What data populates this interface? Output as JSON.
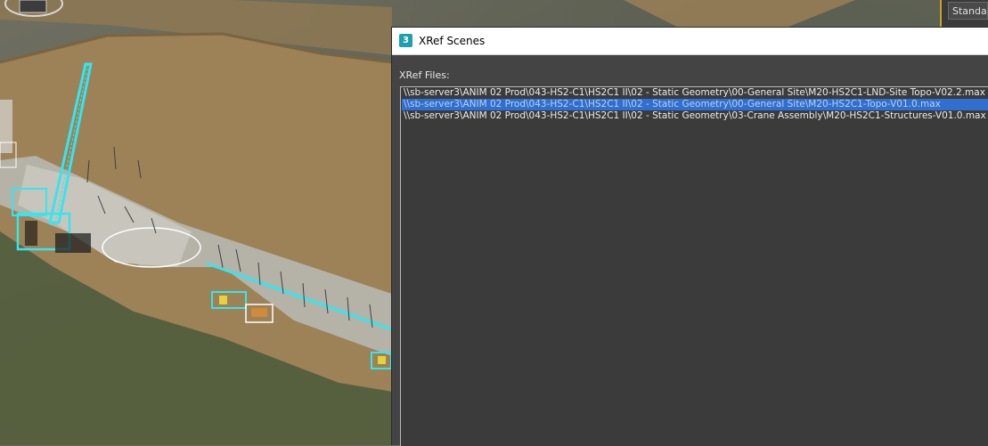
{
  "viewport": {
    "view_button_label": "Standard"
  },
  "dialog": {
    "app_icon_glyph": "3",
    "title": "XRef Scenes",
    "files_label": "XRef Files:",
    "files": [
      {
        "path": "\\\\sb-server3\\ANIM 02 Prod\\043-HS2-C1\\HS2C1 II\\02 - Static Geometry\\00-General Site\\M20-HS2C1-LND-Site Topo-V02.2.max",
        "selected": false
      },
      {
        "path": "\\\\sb-server3\\ANIM 02 Prod\\043-HS2-C1\\HS2C1 II\\02 - Static Geometry\\00-General Site\\M20-HS2C1-Topo-V01.0.max",
        "selected": true
      },
      {
        "path": "\\\\sb-server3\\ANIM 02 Prod\\043-HS2-C1\\HS2C1 II\\02 - Static Geometry\\03-Crane Assembly\\M20-HS2C1-Structures-V01.0.max",
        "selected": false
      }
    ]
  },
  "colors": {
    "selection": "#2f6fd0",
    "wireframe": "#33e6f0",
    "terrain": "#9d8157",
    "dialog_bg": "#444444",
    "list_bg": "#3b3b3b",
    "app_icon": "#1e9fb0"
  },
  "icons": {
    "app": "3ds-max-icon",
    "gizmo": "viewcube-icon"
  }
}
